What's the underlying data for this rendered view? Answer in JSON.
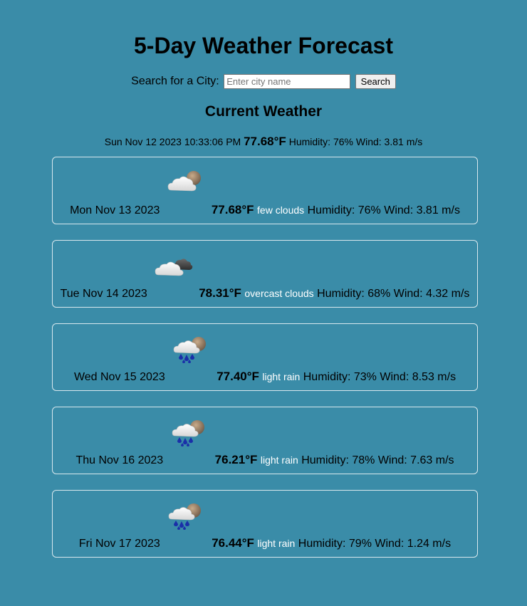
{
  "header": {
    "title": "5-Day Weather Forecast"
  },
  "search": {
    "label": "Search for a City:",
    "placeholder": "Enter city name",
    "value": "",
    "button_label": "Search"
  },
  "current": {
    "heading": "Current Weather",
    "datetime": "Sun Nov 12 2023 10:33:06 PM",
    "temp": "77.68°F",
    "humidity": "Humidity: 76%",
    "wind": "Wind: 3.81 m/s"
  },
  "forecast": [
    {
      "date": "Mon Nov 13 2023",
      "icon": "few-clouds-night-icon",
      "temp": "77.68°F",
      "desc": "few clouds",
      "humidity": "Humidity: 76%",
      "wind": "Wind: 3.81 m/s"
    },
    {
      "date": "Tue Nov 14 2023",
      "icon": "overcast-clouds-icon",
      "temp": "78.31°F",
      "desc": "overcast clouds",
      "humidity": "Humidity: 68%",
      "wind": "Wind: 4.32 m/s"
    },
    {
      "date": "Wed Nov 15 2023",
      "icon": "light-rain-icon",
      "temp": "77.40°F",
      "desc": "light rain",
      "humidity": "Humidity: 73%",
      "wind": "Wind: 8.53 m/s"
    },
    {
      "date": "Thu Nov 16 2023",
      "icon": "light-rain-icon",
      "temp": "76.21°F",
      "desc": "light rain",
      "humidity": "Humidity: 78%",
      "wind": "Wind: 7.63 m/s"
    },
    {
      "date": "Fri Nov 17 2023",
      "icon": "light-rain-icon",
      "temp": "76.44°F",
      "desc": "light rain",
      "humidity": "Humidity: 79%",
      "wind": "Wind: 1.24 m/s"
    }
  ],
  "colors": {
    "background": "#3a8ca8",
    "card_border": "#d8e8ee",
    "description_text": "#ffffff"
  }
}
